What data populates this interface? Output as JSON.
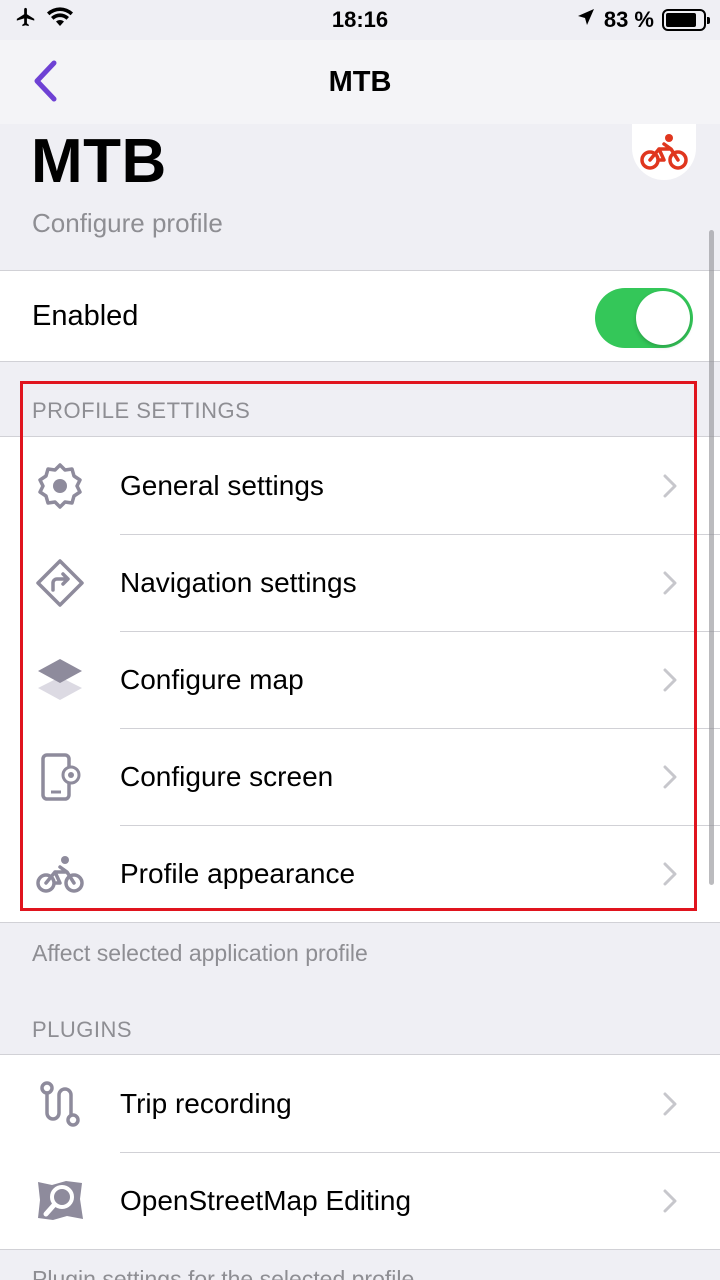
{
  "status_bar": {
    "time": "18:16",
    "battery_percent": "83 %",
    "battery_level": 0.83
  },
  "nav": {
    "title": "MTB"
  },
  "header": {
    "title": "MTB",
    "subtitle": "Configure profile",
    "avatar_icon": "bicycle-icon",
    "accent_color": "#e0361e"
  },
  "enabled": {
    "label": "Enabled",
    "on": true
  },
  "profile_settings": {
    "header": "PROFILE SETTINGS",
    "footer": "Affect selected application profile",
    "items": [
      {
        "label": "General settings",
        "icon": "gear-icon"
      },
      {
        "label": "Navigation settings",
        "icon": "navigation-sign-icon"
      },
      {
        "label": "Configure map",
        "icon": "map-layers-icon"
      },
      {
        "label": "Configure screen",
        "icon": "phone-settings-icon"
      },
      {
        "label": "Profile appearance",
        "icon": "bicycle-icon"
      }
    ]
  },
  "plugins": {
    "header": "PLUGINS",
    "footer": "Plugin settings for the selected profile",
    "items": [
      {
        "label": "Trip recording",
        "icon": "trip-route-icon"
      },
      {
        "label": "OpenStreetMap Editing",
        "icon": "osm-editing-icon"
      }
    ]
  },
  "colors": {
    "tint": "#6e41d4",
    "icon_gray": "#8e8b9c",
    "toggle_on": "#34c759",
    "highlight": "#e0141e"
  }
}
